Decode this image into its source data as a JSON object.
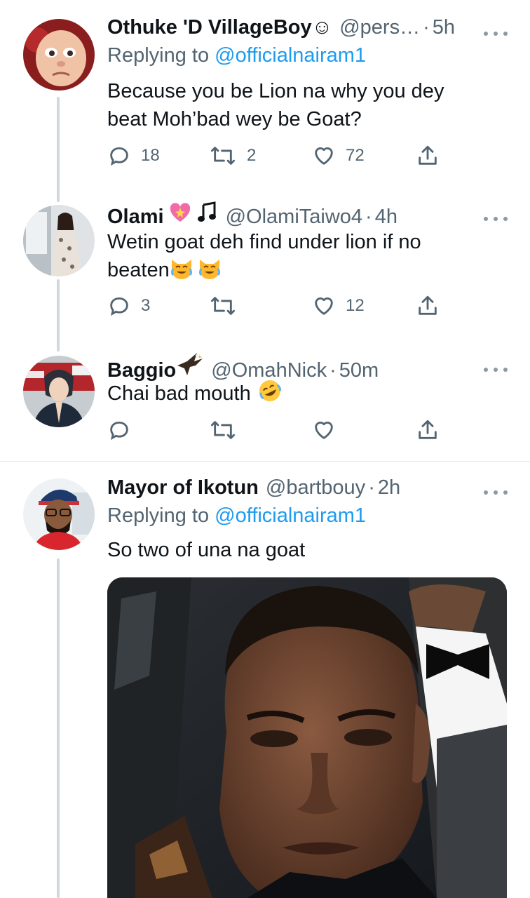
{
  "tweets": [
    {
      "name": "Othuke 'D VillageBoy☺",
      "handle": "@pers…",
      "time": "5h",
      "replying_label": "Replying to",
      "replying_to": "@officialnairam1",
      "text_lines": [
        "Because you be Lion na why you dey",
        "beat Moh’bad wey be Goat?"
      ],
      "replies": "18",
      "retweets": "2",
      "likes": "72"
    },
    {
      "name": "Olami",
      "name_emoji": [
        "sparkling-heart-emoji",
        "musical-note-emoji"
      ],
      "handle": "@OlamiTaiwo4",
      "time": "4h",
      "text_lines": [
        "Wetin goat deh find under lion if no",
        "beaten"
      ],
      "text_emoji": [
        "crying-cat-emoji",
        "crying-cat-emoji"
      ],
      "replies": "3",
      "retweets": "",
      "likes": "12"
    },
    {
      "name": "Baggio",
      "name_emoji": [
        "eagle-emoji"
      ],
      "handle": "@OmahNick",
      "time": "50m",
      "text_lines": [
        "Chai bad mouth"
      ],
      "text_emoji": [
        "rolling-on-floor-laughing-emoji"
      ],
      "replies": "",
      "retweets": "",
      "likes": ""
    },
    {
      "name": "Mayor of Ikotun",
      "handle": "@bartbouy",
      "time": "2h",
      "replying_label": "Replying to",
      "replying_to": "@officialnairam1",
      "text_lines": [
        "So two of una na goat"
      ],
      "media": "photo-man-in-tuxedo"
    }
  ],
  "separator": "·",
  "colors": {
    "link": "#1d9bf0",
    "secondary": "#536471",
    "thread_line": "#cfd9de",
    "divider": "#e1e5e8"
  }
}
